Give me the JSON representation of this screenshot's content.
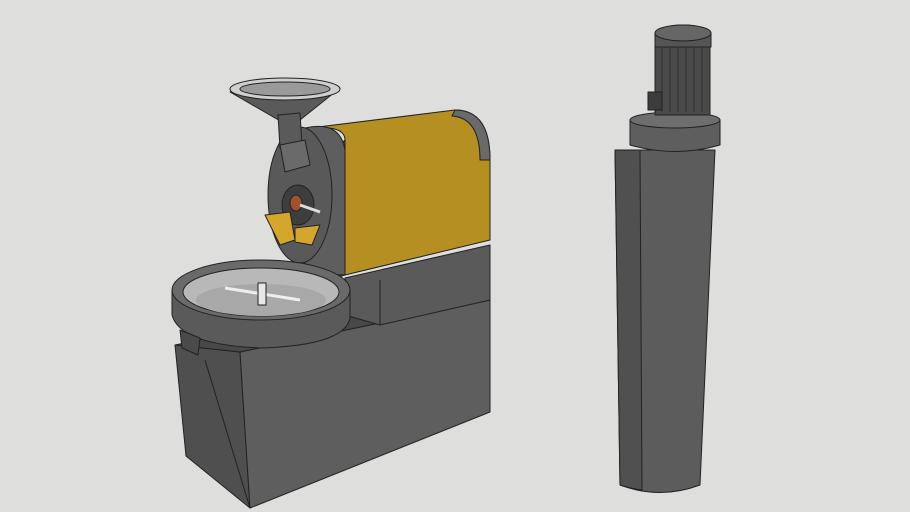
{
  "scene": {
    "background_color": "#dededc",
    "body_color": "#5c5c5c",
    "drum_color": "#b58f22",
    "metal_color": "#c8c8c8"
  }
}
